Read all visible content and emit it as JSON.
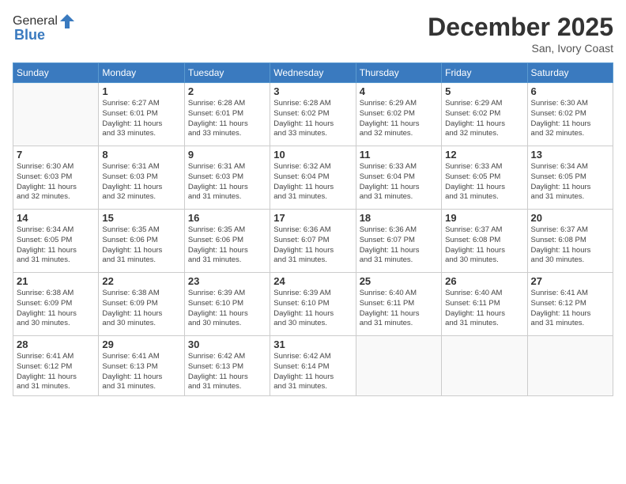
{
  "header": {
    "logo_general": "General",
    "logo_blue": "Blue",
    "month_title": "December 2025",
    "location": "San, Ivory Coast"
  },
  "days_of_week": [
    "Sunday",
    "Monday",
    "Tuesday",
    "Wednesday",
    "Thursday",
    "Friday",
    "Saturday"
  ],
  "weeks": [
    [
      {
        "day": "",
        "info": ""
      },
      {
        "day": "1",
        "info": "Sunrise: 6:27 AM\nSunset: 6:01 PM\nDaylight: 11 hours\nand 33 minutes."
      },
      {
        "day": "2",
        "info": "Sunrise: 6:28 AM\nSunset: 6:01 PM\nDaylight: 11 hours\nand 33 minutes."
      },
      {
        "day": "3",
        "info": "Sunrise: 6:28 AM\nSunset: 6:02 PM\nDaylight: 11 hours\nand 33 minutes."
      },
      {
        "day": "4",
        "info": "Sunrise: 6:29 AM\nSunset: 6:02 PM\nDaylight: 11 hours\nand 32 minutes."
      },
      {
        "day": "5",
        "info": "Sunrise: 6:29 AM\nSunset: 6:02 PM\nDaylight: 11 hours\nand 32 minutes."
      },
      {
        "day": "6",
        "info": "Sunrise: 6:30 AM\nSunset: 6:02 PM\nDaylight: 11 hours\nand 32 minutes."
      }
    ],
    [
      {
        "day": "7",
        "info": "Sunrise: 6:30 AM\nSunset: 6:03 PM\nDaylight: 11 hours\nand 32 minutes."
      },
      {
        "day": "8",
        "info": "Sunrise: 6:31 AM\nSunset: 6:03 PM\nDaylight: 11 hours\nand 32 minutes."
      },
      {
        "day": "9",
        "info": "Sunrise: 6:31 AM\nSunset: 6:03 PM\nDaylight: 11 hours\nand 31 minutes."
      },
      {
        "day": "10",
        "info": "Sunrise: 6:32 AM\nSunset: 6:04 PM\nDaylight: 11 hours\nand 31 minutes."
      },
      {
        "day": "11",
        "info": "Sunrise: 6:33 AM\nSunset: 6:04 PM\nDaylight: 11 hours\nand 31 minutes."
      },
      {
        "day": "12",
        "info": "Sunrise: 6:33 AM\nSunset: 6:05 PM\nDaylight: 11 hours\nand 31 minutes."
      },
      {
        "day": "13",
        "info": "Sunrise: 6:34 AM\nSunset: 6:05 PM\nDaylight: 11 hours\nand 31 minutes."
      }
    ],
    [
      {
        "day": "14",
        "info": "Sunrise: 6:34 AM\nSunset: 6:05 PM\nDaylight: 11 hours\nand 31 minutes."
      },
      {
        "day": "15",
        "info": "Sunrise: 6:35 AM\nSunset: 6:06 PM\nDaylight: 11 hours\nand 31 minutes."
      },
      {
        "day": "16",
        "info": "Sunrise: 6:35 AM\nSunset: 6:06 PM\nDaylight: 11 hours\nand 31 minutes."
      },
      {
        "day": "17",
        "info": "Sunrise: 6:36 AM\nSunset: 6:07 PM\nDaylight: 11 hours\nand 31 minutes."
      },
      {
        "day": "18",
        "info": "Sunrise: 6:36 AM\nSunset: 6:07 PM\nDaylight: 11 hours\nand 31 minutes."
      },
      {
        "day": "19",
        "info": "Sunrise: 6:37 AM\nSunset: 6:08 PM\nDaylight: 11 hours\nand 30 minutes."
      },
      {
        "day": "20",
        "info": "Sunrise: 6:37 AM\nSunset: 6:08 PM\nDaylight: 11 hours\nand 30 minutes."
      }
    ],
    [
      {
        "day": "21",
        "info": "Sunrise: 6:38 AM\nSunset: 6:09 PM\nDaylight: 11 hours\nand 30 minutes."
      },
      {
        "day": "22",
        "info": "Sunrise: 6:38 AM\nSunset: 6:09 PM\nDaylight: 11 hours\nand 30 minutes."
      },
      {
        "day": "23",
        "info": "Sunrise: 6:39 AM\nSunset: 6:10 PM\nDaylight: 11 hours\nand 30 minutes."
      },
      {
        "day": "24",
        "info": "Sunrise: 6:39 AM\nSunset: 6:10 PM\nDaylight: 11 hours\nand 30 minutes."
      },
      {
        "day": "25",
        "info": "Sunrise: 6:40 AM\nSunset: 6:11 PM\nDaylight: 11 hours\nand 31 minutes."
      },
      {
        "day": "26",
        "info": "Sunrise: 6:40 AM\nSunset: 6:11 PM\nDaylight: 11 hours\nand 31 minutes."
      },
      {
        "day": "27",
        "info": "Sunrise: 6:41 AM\nSunset: 6:12 PM\nDaylight: 11 hours\nand 31 minutes."
      }
    ],
    [
      {
        "day": "28",
        "info": "Sunrise: 6:41 AM\nSunset: 6:12 PM\nDaylight: 11 hours\nand 31 minutes."
      },
      {
        "day": "29",
        "info": "Sunrise: 6:41 AM\nSunset: 6:13 PM\nDaylight: 11 hours\nand 31 minutes."
      },
      {
        "day": "30",
        "info": "Sunrise: 6:42 AM\nSunset: 6:13 PM\nDaylight: 11 hours\nand 31 minutes."
      },
      {
        "day": "31",
        "info": "Sunrise: 6:42 AM\nSunset: 6:14 PM\nDaylight: 11 hours\nand 31 minutes."
      },
      {
        "day": "",
        "info": ""
      },
      {
        "day": "",
        "info": ""
      },
      {
        "day": "",
        "info": ""
      }
    ]
  ]
}
